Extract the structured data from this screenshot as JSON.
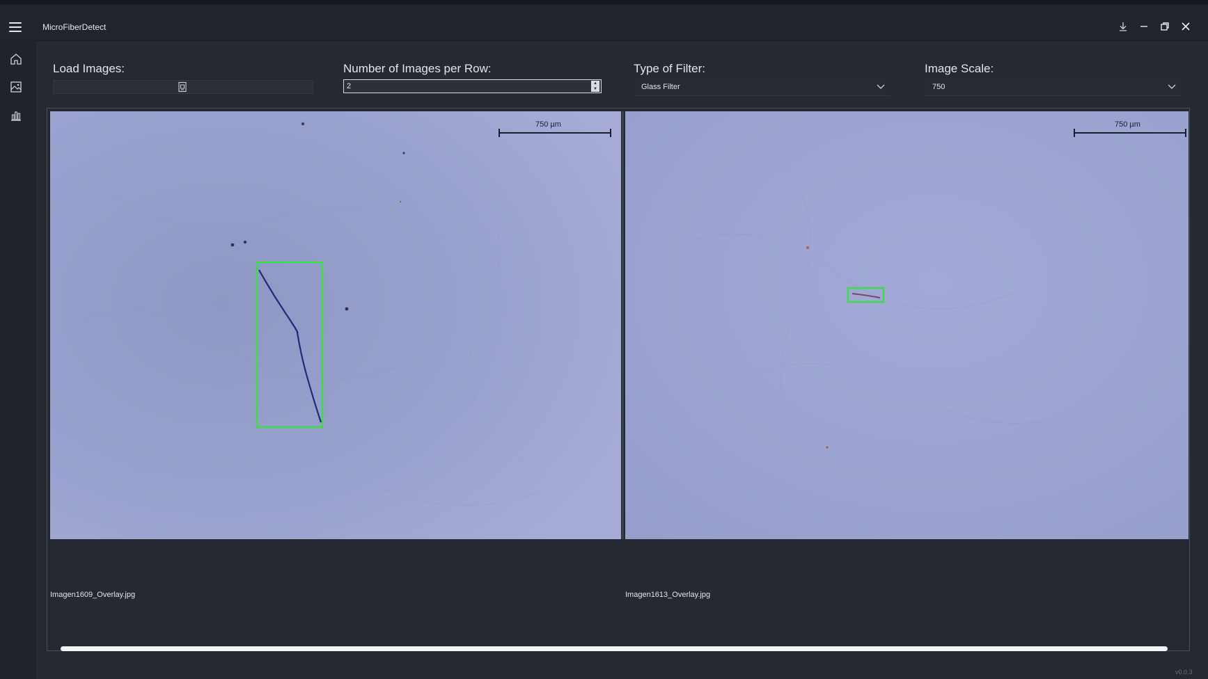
{
  "window": {
    "title": "MicroFiberDetect",
    "controls": [
      "download-icon",
      "minimize-icon",
      "restore-icon",
      "close-icon"
    ]
  },
  "sidebar": {
    "items": [
      {
        "icon": "home-icon"
      },
      {
        "icon": "image-icon"
      },
      {
        "icon": "chart-icon"
      }
    ]
  },
  "controls": {
    "load_images": {
      "label": "Load Images:",
      "icon": "folder-icon"
    },
    "images_per_row": {
      "label": "Number of Images per Row:",
      "value": "2"
    },
    "filter_type": {
      "label": "Type of Filter:",
      "value": "Glass Filter"
    },
    "image_scale": {
      "label": "Image Scale:",
      "value": "750"
    }
  },
  "images": [
    {
      "filename": "Imagen1609_Overlay.jpg",
      "scale_label": "750 µm"
    },
    {
      "filename": "Imagen1613_Overlay.jpg",
      "scale_label": "750 µm"
    }
  ],
  "colors": {
    "detection_box": "#3ddc4a",
    "image_background": "#9aa2cf",
    "app_background": "#242932"
  },
  "footer": {
    "version": "v0.0.3"
  }
}
